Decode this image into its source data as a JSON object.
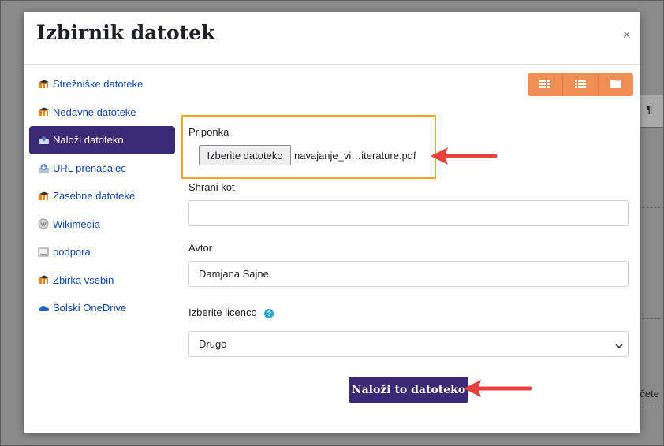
{
  "dialog": {
    "title": "Izbirnik datotek",
    "close_symbol": "×"
  },
  "sidebar": {
    "items": [
      {
        "label": "Strežniške datoteke",
        "icon": "moodle-icon",
        "active": false
      },
      {
        "label": "Nedavne datoteke",
        "icon": "moodle-icon",
        "active": false
      },
      {
        "label": "Naloži datoteko",
        "icon": "upload-icon",
        "active": true
      },
      {
        "label": "URL prenašalec",
        "icon": "url-download-icon",
        "active": false
      },
      {
        "label": "Zasebne datoteke",
        "icon": "moodle-icon",
        "active": false
      },
      {
        "label": "Wikimedia",
        "icon": "wikimedia-icon",
        "active": false
      },
      {
        "label": "podpora",
        "icon": "folder-icon",
        "active": false
      },
      {
        "label": "Zbirka vsebin",
        "icon": "moodle-icon",
        "active": false
      },
      {
        "label": "Šolski OneDrive",
        "icon": "onedrive-icon",
        "active": false
      }
    ]
  },
  "view_toggle": [
    "grid-view-icon",
    "list-view-icon",
    "folder-view-icon"
  ],
  "form": {
    "attachment_label": "Priponka",
    "choose_file_button": "Izberite datoteko",
    "chosen_file_name": "navajanje_vi…iterature.pdf",
    "save_as_label": "Shrani kot",
    "save_as_value": "",
    "author_label": "Avtor",
    "author_value": "Damjana Šajne",
    "license_label": "Izberite licenco",
    "license_value": "Drugo",
    "submit_button": "Naloži to datoteko"
  },
  "colors": {
    "accent_purple": "#3a2a73",
    "link_blue": "#0f47ad",
    "toggle_orange": "#ef8f55",
    "highlight_border": "#f4a623",
    "annotation_arrow": "#e8403a",
    "help_blue": "#27a4d8"
  },
  "background": {
    "partial_text": "čete",
    "toolbar_glyph": "¶"
  }
}
